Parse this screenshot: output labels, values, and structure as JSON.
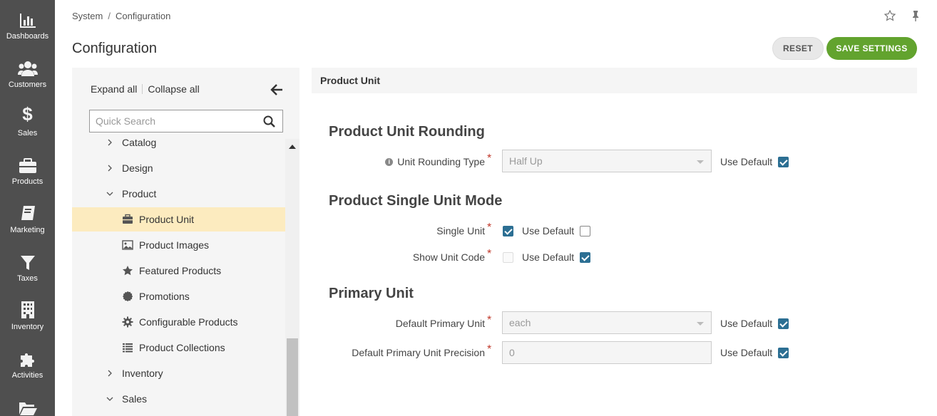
{
  "nav": [
    {
      "label": "Dashboards",
      "icon": "dashboards-icon"
    },
    {
      "label": "Customers",
      "icon": "customers-icon"
    },
    {
      "label": "Sales",
      "icon": "sales-icon"
    },
    {
      "label": "Products",
      "icon": "products-icon"
    },
    {
      "label": "Marketing",
      "icon": "marketing-icon"
    },
    {
      "label": "Taxes",
      "icon": "taxes-icon"
    },
    {
      "label": "Inventory",
      "icon": "inventory-icon"
    },
    {
      "label": "Activities",
      "icon": "activities-icon"
    },
    {
      "label": "",
      "icon": "folder-icon"
    }
  ],
  "breadcrumb": {
    "first": "System",
    "sep": "/",
    "second": "Configuration"
  },
  "page": {
    "title": "Configuration"
  },
  "actions": {
    "reset": "RESET",
    "save": "SAVE SETTINGS"
  },
  "tree": {
    "expand_all": "Expand all",
    "collapse_all": "Collapse all",
    "search_placeholder": "Quick Search",
    "items": [
      {
        "label": "Catalog",
        "state": "collapsed"
      },
      {
        "label": "Design",
        "state": "collapsed"
      },
      {
        "label": "Product",
        "state": "expanded"
      },
      {
        "label": "Product Unit",
        "icon": "briefcase-icon",
        "selected": true
      },
      {
        "label": "Product Images",
        "icon": "image-icon"
      },
      {
        "label": "Featured Products",
        "icon": "star-icon"
      },
      {
        "label": "Promotions",
        "icon": "badge-icon"
      },
      {
        "label": "Configurable Products",
        "icon": "cog-icon"
      },
      {
        "label": "Product Collections",
        "icon": "list-icon"
      },
      {
        "label": "Inventory",
        "state": "collapsed"
      },
      {
        "label": "Sales",
        "state": "expanded"
      }
    ]
  },
  "content": {
    "section_title": "Product Unit",
    "groups": {
      "rounding": {
        "title": "Product Unit Rounding",
        "rounding_type": {
          "label": "Unit Rounding Type",
          "value": "Half Up",
          "use_default": "Use Default",
          "use_default_checked": true
        }
      },
      "single_unit_mode": {
        "title": "Product Single Unit Mode",
        "single_unit": {
          "label": "Single Unit",
          "checked": true,
          "use_default": "Use Default",
          "use_default_checked": false
        },
        "show_unit_code": {
          "label": "Show Unit Code",
          "checked": false,
          "use_default": "Use Default",
          "use_default_checked": true
        }
      },
      "primary_unit": {
        "title": "Primary Unit",
        "default_primary_unit": {
          "label": "Default Primary Unit",
          "value": "each",
          "use_default": "Use Default",
          "use_default_checked": true
        },
        "default_precision": {
          "label": "Default Primary Unit Precision",
          "value": "0",
          "use_default": "Use Default",
          "use_default_checked": true
        }
      }
    },
    "required_mark": "*"
  },
  "colors": {
    "nav_bg": "#4f4f4f",
    "save": "#62a32e",
    "selected": "#fcebbf",
    "checkbox": "#2c6f93",
    "required": "#c0392b"
  }
}
